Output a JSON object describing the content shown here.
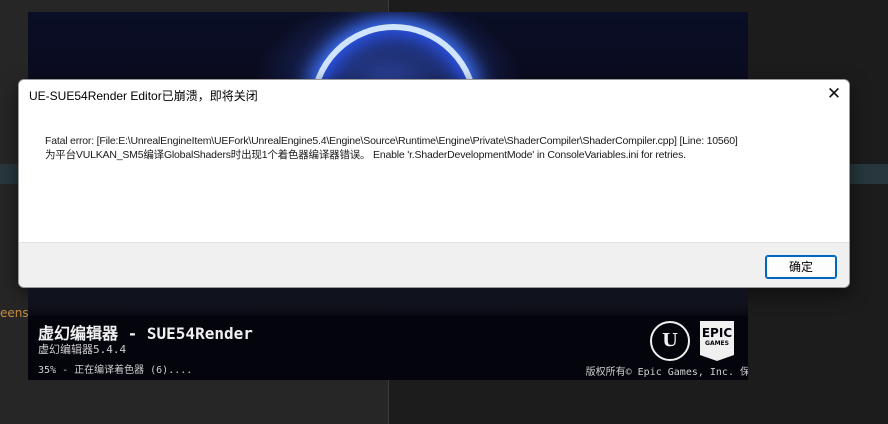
{
  "background": {
    "edge_text": "eensho"
  },
  "splash": {
    "title": "虚幻编辑器 - SUE54Render",
    "version": "虚幻编辑器5.4.4",
    "progress": "35% - 正在编译着色器 (6)....",
    "copyright": "版权所有© Epic Games, Inc. 保",
    "ue_logo": "U",
    "epic_logo_top": "EPIC",
    "epic_logo_bottom": "GAMES"
  },
  "dialog": {
    "title": "UE-SUE54Render Editor已崩溃，即将关闭",
    "close_glyph": "✕",
    "message_line1": "Fatal error: [File:E:\\UnrealEngineItem\\UEFork\\UnrealEngine5.4\\Engine\\Source\\Runtime\\Engine\\Private\\ShaderCompiler\\ShaderCompiler.cpp] [Line: 10560]",
    "message_line2": "为平台VULKAN_SM5编译GlobalShaders时出现1个着色器编译器错误。 Enable 'r.ShaderDevelopmentMode' in ConsoleVariables.ini for retries.",
    "ok_label": "确定"
  },
  "icons": {
    "close": "close-icon",
    "ue_logo": "unreal-engine-logo-icon",
    "epic_logo": "epic-games-logo-icon"
  }
}
